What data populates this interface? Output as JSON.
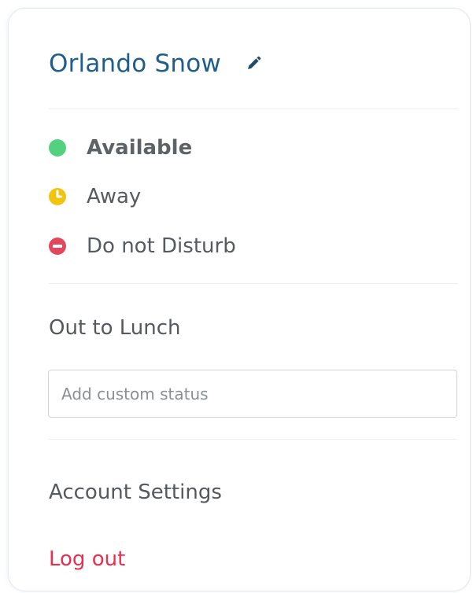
{
  "profile": {
    "name": "Orlando Snow",
    "edit_icon": "pencil-icon"
  },
  "statuses": [
    {
      "label": "Available",
      "icon": "available-dot-icon",
      "color": "#52d17f",
      "selected": true
    },
    {
      "label": "Away",
      "icon": "away-clock-icon",
      "color": "#f1c40f",
      "selected": false
    },
    {
      "label": "Do not Disturb",
      "icon": "do-not-disturb-icon",
      "color": "#e4475c",
      "selected": false
    }
  ],
  "preset_status": "Out to Lunch",
  "custom_status": {
    "value": "",
    "placeholder": "Add custom status"
  },
  "menu": {
    "account_settings": "Account Settings",
    "log_out": "Log out"
  },
  "colors": {
    "name": "#1f5e8a",
    "logout": "#e8304e"
  }
}
